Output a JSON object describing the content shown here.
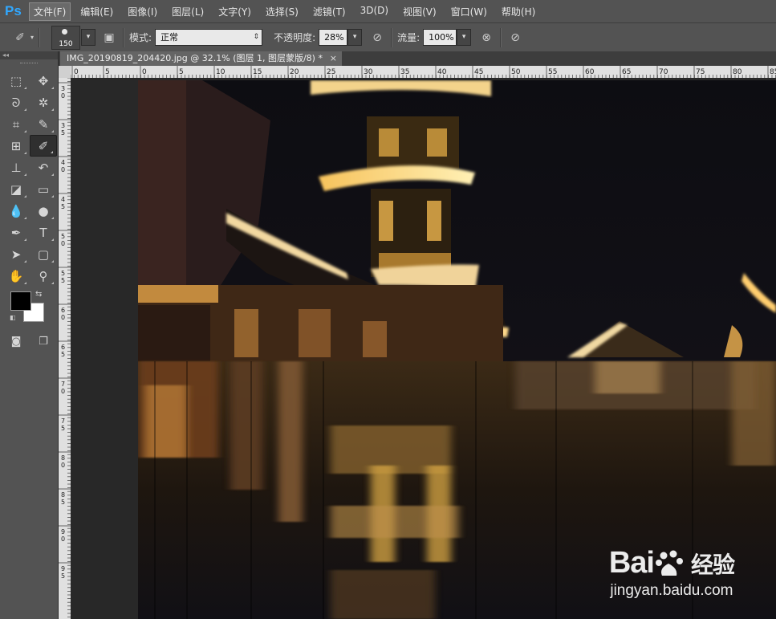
{
  "app": {
    "logo": "Ps"
  },
  "menu": [
    {
      "label": "文件(F)",
      "active": true
    },
    {
      "label": "编辑(E)"
    },
    {
      "label": "图像(I)"
    },
    {
      "label": "图层(L)"
    },
    {
      "label": "文字(Y)"
    },
    {
      "label": "选择(S)"
    },
    {
      "label": "滤镜(T)"
    },
    {
      "label": "3D(D)"
    },
    {
      "label": "视图(V)"
    },
    {
      "label": "窗口(W)"
    },
    {
      "label": "帮助(H)"
    }
  ],
  "options": {
    "brush_size": "150",
    "mode_label": "模式:",
    "mode_value": "正常",
    "opacity_label": "不透明度:",
    "opacity_value": "28%",
    "flow_label": "流量:",
    "flow_value": "100%"
  },
  "document": {
    "tab_title": "IMG_20190819_204420.jpg @ 32.1% (图层 1, 图层蒙版/8) *",
    "close": "×"
  },
  "rulers": {
    "h_labels": [
      "0",
      "5",
      "0",
      "5",
      "10",
      "15",
      "20",
      "25",
      "30",
      "35",
      "40",
      "45",
      "50",
      "55",
      "60",
      "65",
      "70",
      "75",
      "80",
      "85"
    ],
    "v_labels": [
      "3",
      "0",
      "3",
      "5",
      "4",
      "0",
      "4",
      "5",
      "5",
      "0",
      "5",
      "5",
      "6",
      "0",
      "6",
      "5",
      "7",
      "0",
      "7",
      "5",
      "8",
      "0",
      "8",
      "5",
      "9",
      "0",
      "9",
      "5"
    ]
  },
  "tools": [
    {
      "name": "marquee-tool-icon",
      "glyph": "⬚"
    },
    {
      "name": "move-tool-icon",
      "glyph": "✥"
    },
    {
      "name": "lasso-tool-icon",
      "glyph": "ᘐ"
    },
    {
      "name": "magic-wand-tool-icon",
      "glyph": "✲"
    },
    {
      "name": "crop-tool-icon",
      "glyph": "⌗"
    },
    {
      "name": "eyedropper-tool-icon",
      "glyph": "✎"
    },
    {
      "name": "healing-tool-icon",
      "glyph": "⊞"
    },
    {
      "name": "brush-tool-icon",
      "glyph": "✐",
      "selected": true
    },
    {
      "name": "stamp-tool-icon",
      "glyph": "⊥"
    },
    {
      "name": "history-brush-tool-icon",
      "glyph": "↶"
    },
    {
      "name": "eraser-tool-icon",
      "glyph": "◪"
    },
    {
      "name": "gradient-tool-icon",
      "glyph": "▭"
    },
    {
      "name": "blur-tool-icon",
      "glyph": "💧"
    },
    {
      "name": "dodge-tool-icon",
      "glyph": "●"
    },
    {
      "name": "pen-tool-icon",
      "glyph": "✒"
    },
    {
      "name": "type-tool-icon",
      "glyph": "T"
    },
    {
      "name": "path-select-tool-icon",
      "glyph": "➤"
    },
    {
      "name": "shape-tool-icon",
      "glyph": "▢"
    },
    {
      "name": "hand-tool-icon",
      "glyph": "✋"
    },
    {
      "name": "zoom-tool-icon",
      "glyph": "⚲"
    }
  ],
  "colors": {
    "foreground": "#000000",
    "background": "#ffffff",
    "accent": "#31a8ff"
  },
  "watermark": {
    "brand_left": "Bai",
    "brand_right": "经验",
    "url": "jingyan.baidu.com"
  }
}
